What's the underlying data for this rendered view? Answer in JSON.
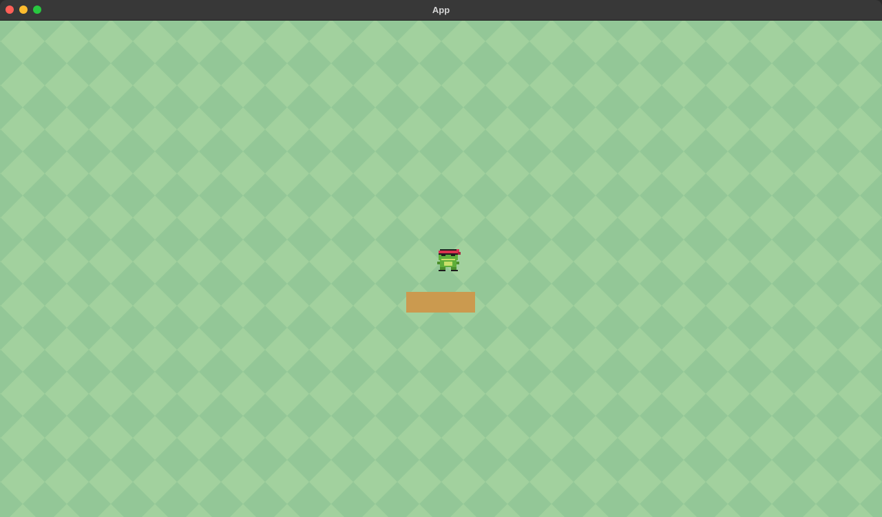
{
  "window": {
    "title": "App"
  },
  "scene": {
    "background_light": "#a2d19e",
    "background_dark": "#93c797",
    "player": {
      "name": "ninja-frog",
      "icon": "frog-character-icon",
      "headband_color": "#d9324f",
      "body_color": "#5fae3a"
    },
    "platform": {
      "color": "#cb9a4f"
    }
  }
}
